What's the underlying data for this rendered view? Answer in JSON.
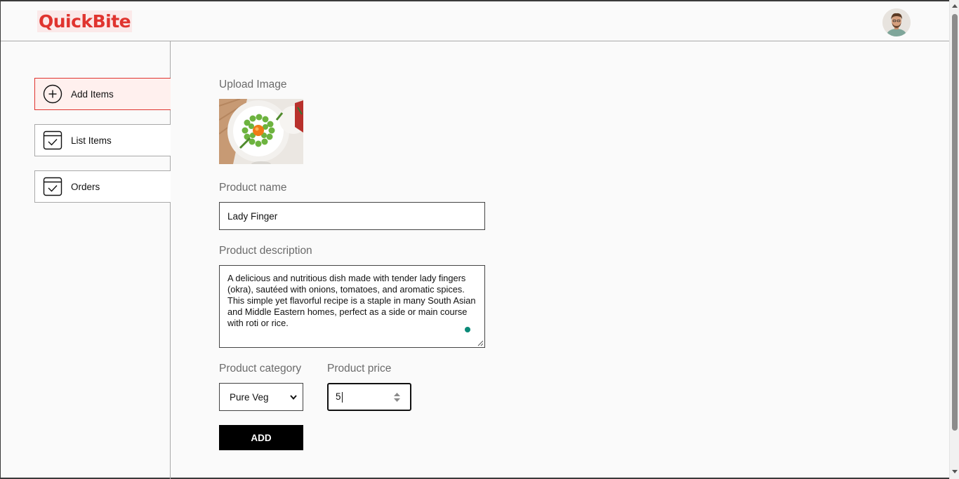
{
  "app": {
    "logo_text": "QuickBite",
    "brand_color": "#e0342f"
  },
  "sidebar": {
    "items": [
      {
        "label": "Add Items",
        "icon": "add-circle-icon",
        "active": true
      },
      {
        "label": "List Items",
        "icon": "checklist-icon",
        "active": false
      },
      {
        "label": "Orders",
        "icon": "checklist-icon",
        "active": false
      }
    ]
  },
  "form": {
    "upload_label": "Upload Image",
    "name_label": "Product name",
    "name_value": "Lady Finger",
    "description_label": "Product description",
    "description_value": "A delicious and nutritious dish made with tender lady fingers (okra), sautéed with onions, tomatoes, and aromatic spices. This simple yet flavorful recipe is a staple in many South Asian and Middle Eastern homes, perfect as a side or main course with roti or rice.",
    "category_label": "Product category",
    "category_value": "Pure Veg",
    "price_label": "Product price",
    "price_value": "5",
    "submit_label": "ADD"
  }
}
